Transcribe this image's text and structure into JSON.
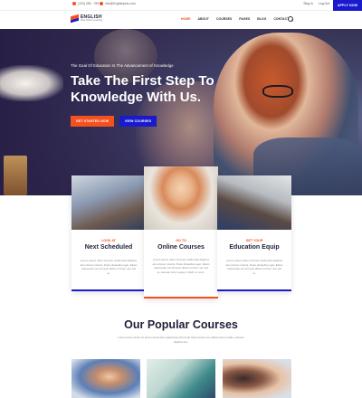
{
  "topbar": {
    "phone": "(123) 456 - 789",
    "email": "info@Englishplus.com",
    "login_label": "Sing In",
    "register_label": "Log Out",
    "apply_label": "APPLY NOW"
  },
  "nav": {
    "brand": "ENGLISH",
    "tagline": "Plus Online Learning",
    "items": [
      "HOME",
      "ABOUT",
      "COURSES",
      "PAGES",
      "BLOG",
      "CONTACT"
    ],
    "active_index": 0
  },
  "hero": {
    "eyebrow": "The Goal Of Education Is The Advancement of Knowledge",
    "headline": "Take The First Step To Knowledge With Us.",
    "primary_button": "GET STARTED NOW",
    "secondary_button": "VIEW COURSES"
  },
  "features": [
    {
      "kicker": "LOOK AT",
      "title": "Next Scheduled",
      "body": "Lorem ipsum dolor sit amet mollis felis dapibus arcu donec viverra. Pede phasellus eget. Etiam maecenas vel vici quis dictum rutrum nec nisi et."
    },
    {
      "kicker": "GO TO",
      "title": "Online Courses",
      "body": "Lorem ipsum dolor sit amet mollis felis dapibus arcu donec viverra. Pede phasellus eget. Etiam maecenas vel vici quis dictum rutrum nec nisi et. Aenean tortor sapien. Morbi ut nunc."
    },
    {
      "kicker": "GET YOUR",
      "title": "Education Equip",
      "body": "Lorem ipsum dolor sit amet mollis felis dapibus arcu donec viverra. Pede phasellus eget. Etiam maecenas vel vici quis dictum rutrum nec nisi et."
    }
  ],
  "popular": {
    "title": "Our Popular Courses",
    "subtitle": "Lorem ipsum dolor sit amet consectetur adipiscing elit Ut elit tellus luctus nec ullamcorper mattis, pulvinar dapibus leo."
  },
  "colors": {
    "accent_orange": "#f4511e",
    "accent_blue": "#1a1acd",
    "heading": "#1f1f3a"
  }
}
